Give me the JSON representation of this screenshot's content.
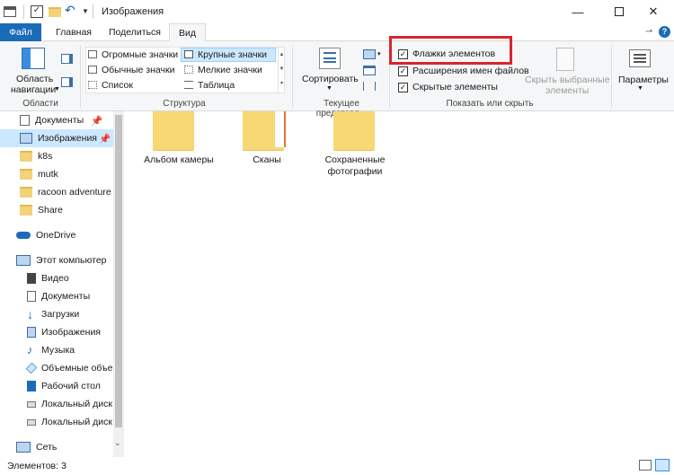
{
  "window": {
    "title": "Изображения",
    "minimize_icon": "minimize-icon",
    "maximize_icon": "maximize-icon",
    "close_icon": "close-icon"
  },
  "ribbon_tabs": [
    {
      "label": "Файл"
    },
    {
      "label": "Главная"
    },
    {
      "label": "Поделиться"
    },
    {
      "label": "Вид"
    }
  ],
  "ribbon": {
    "panes": {
      "nav_label_line1": "Область",
      "nav_label_line2": "навигации",
      "group": "Области"
    },
    "layout": {
      "items": [
        "Огромные значки",
        "Крупные значки",
        "Обычные значки",
        "Мелкие значки",
        "Список",
        "Таблица"
      ],
      "selected": "Крупные значки",
      "group": "Структура"
    },
    "current_view": {
      "sort_label": "Сортировать",
      "group": "Текущее представл..."
    },
    "show_hide": {
      "checkboxes": [
        {
          "label": "Флажки элементов",
          "checked": true
        },
        {
          "label": "Расширения имен файлов",
          "checked": true
        },
        {
          "label": "Скрытые элементы",
          "checked": true
        }
      ],
      "hide_selected_line1": "Скрыть выбранные",
      "hide_selected_line2": "элементы",
      "group": "Показать или скрыть"
    },
    "options": {
      "label": "Параметры"
    }
  },
  "nav": {
    "items": [
      {
        "label": "Документы",
        "pinned": true
      },
      {
        "label": "Изображения",
        "pinned": true
      },
      {
        "label": "k8s"
      },
      {
        "label": "mutk"
      },
      {
        "label": "racoon adventure"
      },
      {
        "label": "Share"
      },
      {
        "label": "OneDrive"
      },
      {
        "label": "Этот компьютер"
      },
      {
        "label": "Видео"
      },
      {
        "label": "Документы"
      },
      {
        "label": "Загрузки"
      },
      {
        "label": "Изображения"
      },
      {
        "label": "Музыка"
      },
      {
        "label": "Объемные объе"
      },
      {
        "label": "Рабочий стол"
      },
      {
        "label": "Локальный диск"
      },
      {
        "label": "Локальный диск"
      },
      {
        "label": "Сеть"
      }
    ]
  },
  "content": {
    "folders": [
      {
        "line1": "Альбом камеры",
        "line2": ""
      },
      {
        "line1": "Сканы",
        "line2": ""
      },
      {
        "line1": "Сохраненные",
        "line2": "фотографии"
      }
    ]
  },
  "status": {
    "count": "Элементов: 3"
  },
  "colors": {
    "accent": "#1a6bb8",
    "highlight": "#d9252b",
    "selection": "#cce8ff"
  }
}
